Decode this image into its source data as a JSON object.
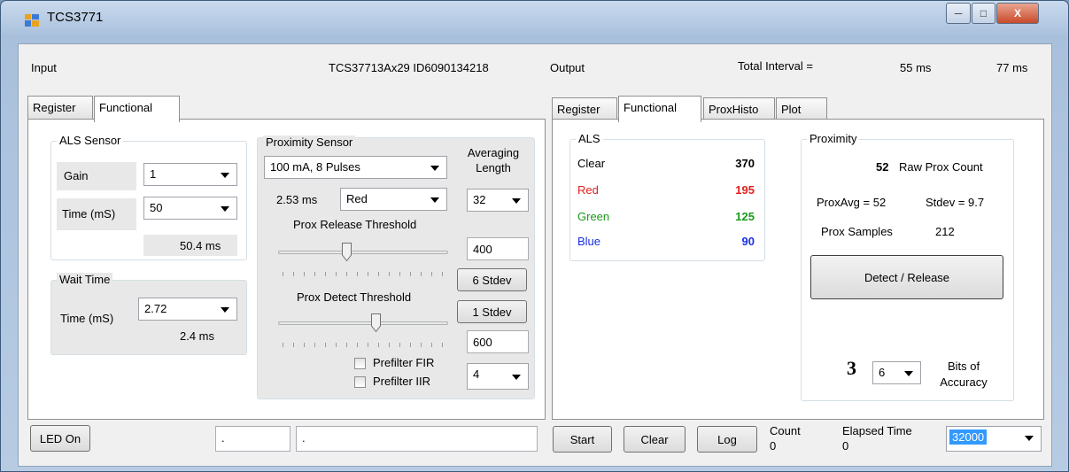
{
  "window": {
    "title": "TCS3771"
  },
  "input": {
    "label": "Input",
    "device_id": "TCS37713Ax29 ID6090134218",
    "tabs": [
      "Register",
      "Functional"
    ],
    "als": {
      "title": "ALS Sensor",
      "gain_label": "Gain",
      "gain_value": "1",
      "time_label": "Time (mS)",
      "time_value": "50",
      "time_readout": "50.4 ms"
    },
    "wait": {
      "title": "Wait Time",
      "time_label": "Time (mS)",
      "time_value": "2.72",
      "time_readout": "2.4 ms"
    },
    "prox": {
      "title": "Proximity Sensor",
      "drive_value": "100 mA, 8 Pulses",
      "pulse_time": "2.53 ms",
      "channel_value": "Red",
      "release_label": "Prox Release Threshold",
      "release_value": "400",
      "release_stdev": "6 Stdev",
      "detect_label": "Prox Detect Threshold",
      "detect_value": "600",
      "detect_stdev": "1 Stdev",
      "release_slider_fraction": 0.4,
      "detect_slider_fraction": 0.58,
      "averaging_label_1": "Averaging",
      "averaging_label_2": "Length",
      "averaging_value": "32",
      "prefilter_fir": "Prefilter FIR",
      "prefilter_iir": "Prefilter IIR",
      "prefilter_value": "4"
    }
  },
  "output": {
    "label": "Output",
    "total_interval_label": "Total Interval =",
    "interval_1": "55 ms",
    "interval_2": "77 ms",
    "tabs": [
      "Register",
      "Functional",
      "ProxHisto",
      "Plot"
    ],
    "als": {
      "title": "ALS",
      "clear_label": "Clear",
      "clear_value": "370",
      "red_label": "Red",
      "red_value": "195",
      "green_label": "Green",
      "green_value": "125",
      "blue_label": "Blue",
      "blue_value": "90"
    },
    "proximity": {
      "title": "Proximity",
      "raw_count": "52",
      "raw_count_label": "Raw Prox Count",
      "prox_avg": "ProxAvg = 52",
      "stdev": "Stdev = 9.7",
      "samples_label": "Prox Samples",
      "samples_value": "212",
      "detect_button": "Detect / Release",
      "accuracy_bits": "3",
      "accuracy_select": "6",
      "accuracy_label_1": "Bits of",
      "accuracy_label_2": "Accuracy"
    }
  },
  "bottom": {
    "led_button": "LED On",
    "field_1": ".",
    "field_2": ".",
    "start_button": "Start",
    "clear_button": "Clear",
    "log_button": "Log",
    "count_label": "Count",
    "count_value": "0",
    "elapsed_label": "Elapsed Time",
    "elapsed_value_1": "0",
    "elapsed_select": "32000"
  },
  "colors": {
    "red": "#e02020",
    "green": "#1a9a1a",
    "blue": "#1a2ee0",
    "selection": "#3399ff"
  }
}
